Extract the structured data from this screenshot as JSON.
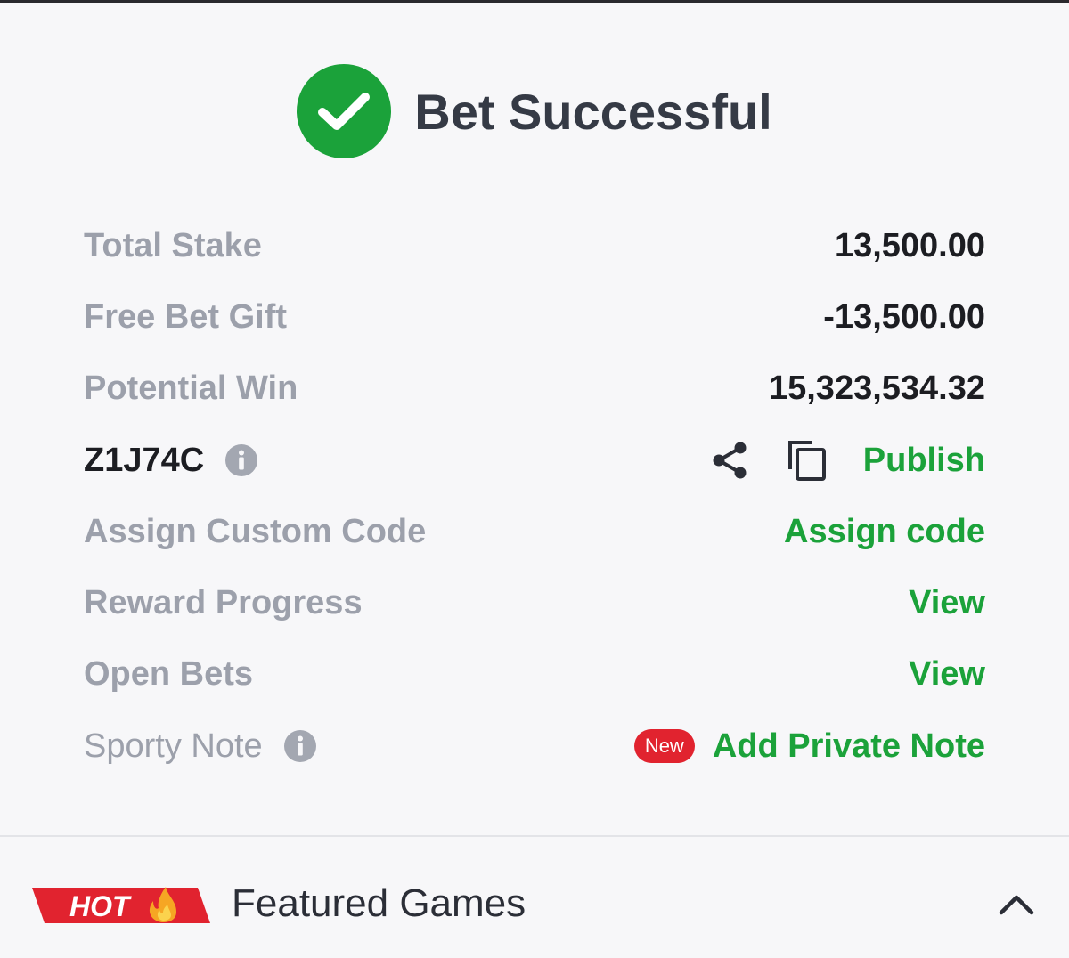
{
  "header": {
    "title": "Bet Successful",
    "status_icon": "check-circle-icon",
    "accent_color": "#1ba23a"
  },
  "summary": {
    "total_stake_label": "Total Stake",
    "total_stake_value": "13,500.00",
    "free_bet_label": "Free Bet Gift",
    "free_bet_value": "-13,500.00",
    "potential_win_label": "Potential Win",
    "potential_win_value": "15,323,534.32"
  },
  "booking": {
    "code": "Z1J74C",
    "publish_label": "Publish"
  },
  "actions": {
    "custom_code_label": "Assign Custom Code",
    "custom_code_link": "Assign code",
    "reward_label": "Reward Progress",
    "reward_link": "View",
    "open_bets_label": "Open Bets",
    "open_bets_link": "View",
    "note_label": "Sporty Note",
    "note_badge": "New",
    "note_link": "Add Private Note"
  },
  "featured": {
    "badge": "HOT",
    "title": "Featured Games"
  },
  "colors": {
    "green": "#1ba23a",
    "red": "#e1232f",
    "label_gray": "#9ca0ab",
    "text_dark": "#1c1d22"
  }
}
